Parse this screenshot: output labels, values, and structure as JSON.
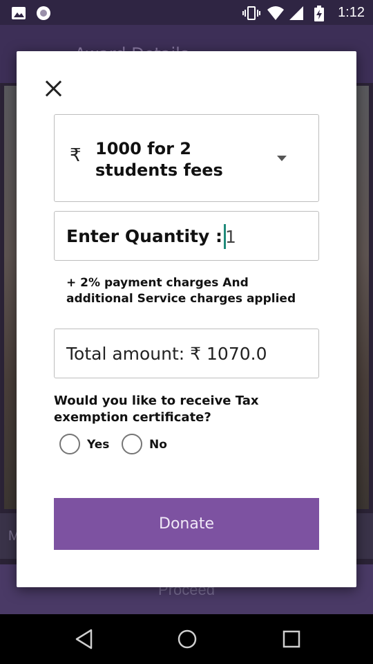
{
  "background": {
    "title": "Award Details",
    "strip_text": "M",
    "proceed_label": "Proceed"
  },
  "status_bar": {
    "time": "1:12",
    "icons": [
      "image-icon",
      "record-icon",
      "vibrate-icon",
      "wifi-icon",
      "signal-icon",
      "battery-charging-icon"
    ]
  },
  "dialog": {
    "plan": {
      "currency_symbol": "₹",
      "selected_value": "1000 for 2 students fees"
    },
    "quantity": {
      "label": "Enter Quantity :",
      "value": "1"
    },
    "charges_note": "+ 2% payment charges And additional Service charges applied",
    "total": {
      "text": "Total amount: ₹ 1070.0"
    },
    "tax_exemption": {
      "question": "Would you like to receive Tax exemption certificate?",
      "options": [
        "Yes",
        "No"
      ]
    },
    "donate_label": "Donate"
  },
  "colors": {
    "accent": "#7d52a1",
    "caret": "#1f8a7a"
  }
}
